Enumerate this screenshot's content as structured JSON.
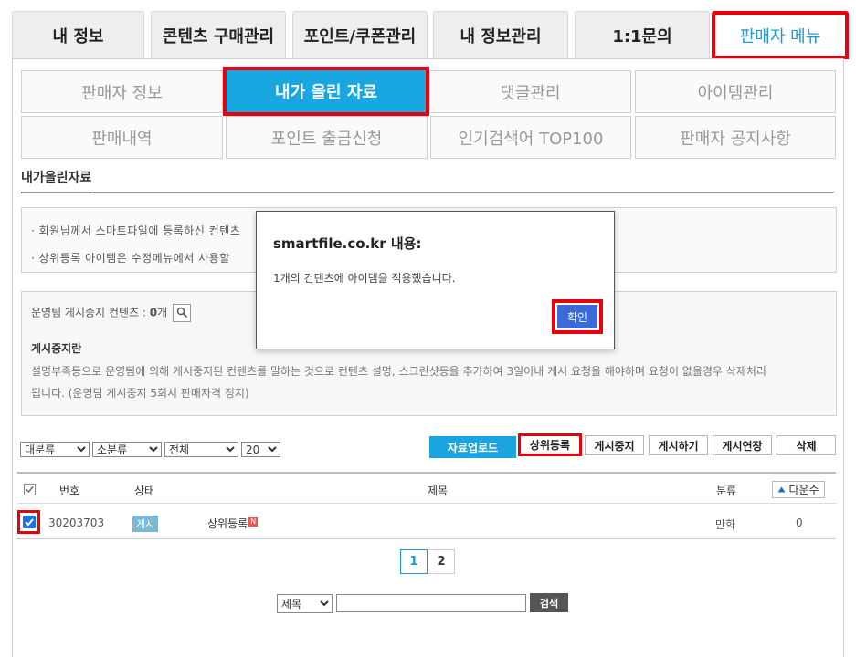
{
  "top_tabs": [
    {
      "label": "내 정보"
    },
    {
      "label": "콘텐츠 구매관리"
    },
    {
      "label": "포인트/쿠폰관리"
    },
    {
      "label": "내 정보관리"
    },
    {
      "label": "1:1문의"
    },
    {
      "label": "판매자 메뉴"
    }
  ],
  "sub_menu": [
    {
      "label": "판매자 정보"
    },
    {
      "label": "내가 올린 자료"
    },
    {
      "label": "댓글관리"
    },
    {
      "label": "아이템관리"
    },
    {
      "label": "판매내역"
    },
    {
      "label": "포인트 출금신청"
    },
    {
      "label": "인기검색어 TOP100"
    },
    {
      "label": "판매자 공지사항"
    }
  ],
  "section_title": "내가올린자료",
  "info_lines": [
    "· 회원님께서 스마트파일에 등록하신 컨텐츠",
    "· 상위등록 아이템은 수정메뉴에서 사용할"
  ],
  "notice": {
    "suspended_label": "운영팀 게시중지 컨텐츠 : ",
    "suspended_count": "0",
    "suspended_unit": "개",
    "heading": "게시중지란",
    "body_line1": "설명부족등으로 운영팀에 의해 게시중지된 컨텐츠를 말하는 것으로 컨텐츠 설명, 스크린샷등을 추가하여 3일이내 게시 요청을 해야하며 요청이 없을경우 삭제처리",
    "body_line2": "됩니다. (운영팀 게시중지 5회시 판매자격 정지)"
  },
  "filters": {
    "category_main": "대분류",
    "category_sub": "소분류",
    "status": "전체",
    "page_size": "20"
  },
  "actions": {
    "upload": "자료업로드",
    "top_register": "상위등록",
    "suspend": "게시중지",
    "publish": "게시하기",
    "extend": "게시연장",
    "delete": "삭제"
  },
  "table": {
    "headers": {
      "number": "번호",
      "status": "상태",
      "title": "제목",
      "category": "분류",
      "downloads": "다운수"
    },
    "rows": [
      {
        "number": "30203703",
        "status": "게시",
        "title": "상위등록",
        "new_badge": "N",
        "category": "만화",
        "downloads": "0"
      }
    ]
  },
  "pagination": [
    "1",
    "2"
  ],
  "search": {
    "field": "제목",
    "value": "",
    "button": "검색"
  },
  "dialog": {
    "title": "smartfile.co.kr 내용:",
    "message": "1개의 컨텐츠에 아이템을 적용했습니다.",
    "ok_label": "확인"
  },
  "colors": {
    "accent": "#1ba5e0",
    "highlight": "#e8000c",
    "dialog_button": "#3a6ad6"
  }
}
